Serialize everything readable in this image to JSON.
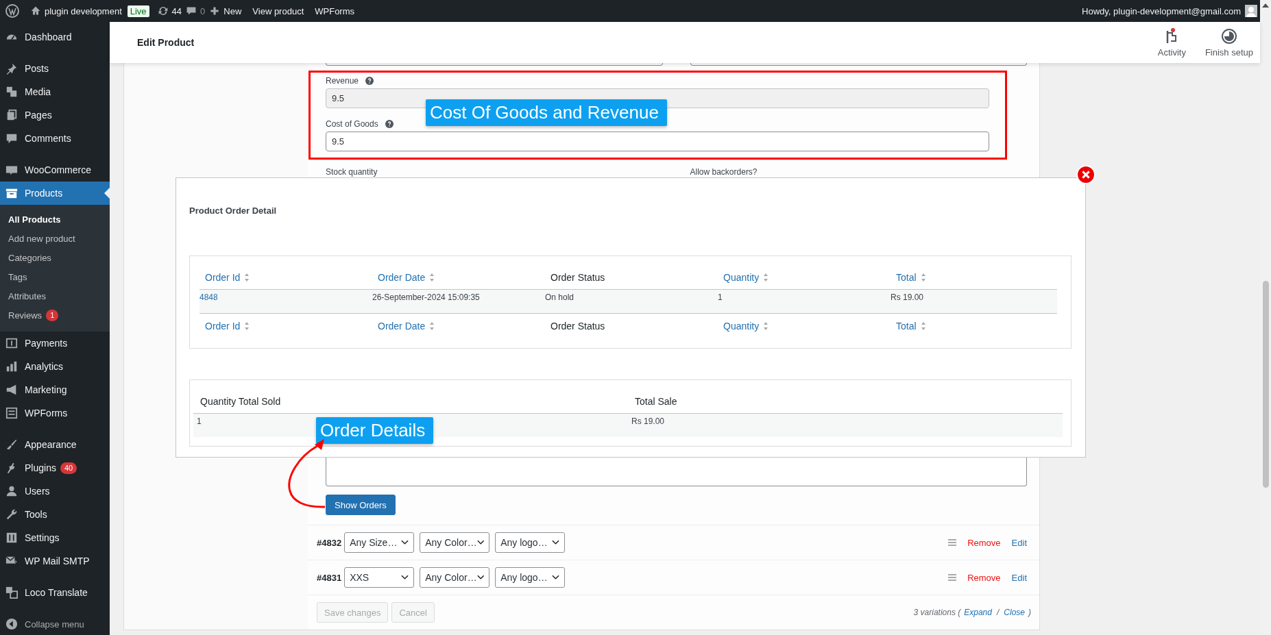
{
  "admin_bar": {
    "site": "plugin development",
    "badge": "Live",
    "updates": "44",
    "comments": "0",
    "new": "New",
    "links": [
      "View product",
      "WPForms"
    ],
    "greeting": "Howdy, plugin-development@gmail.com"
  },
  "sidebar": {
    "groups": [
      [
        {
          "label": "Dashboard",
          "selected": false
        }
      ],
      [
        {
          "label": "Posts",
          "selected": false
        },
        {
          "label": "Media",
          "selected": false
        },
        {
          "label": "Pages",
          "selected": false
        },
        {
          "label": "Comments",
          "selected": false
        }
      ],
      [
        {
          "label": "WooCommerce",
          "selected": false
        },
        {
          "label": "Products",
          "selected": true,
          "children": [
            {
              "label": "All Products",
              "selected": true
            },
            {
              "label": "Add new product",
              "selected": false
            },
            {
              "label": "Categories",
              "selected": false
            },
            {
              "label": "Tags",
              "selected": false
            },
            {
              "label": "Attributes",
              "selected": false
            },
            {
              "label": "Reviews",
              "selected": false,
              "badge": "1"
            }
          ]
        },
        {
          "label": "Payments",
          "selected": false
        },
        {
          "label": "Analytics",
          "selected": false
        },
        {
          "label": "Marketing",
          "selected": false
        },
        {
          "label": "WPForms",
          "selected": false
        }
      ],
      [
        {
          "label": "Appearance",
          "selected": false
        },
        {
          "label": "Plugins",
          "selected": false,
          "badge": "40"
        },
        {
          "label": "Users",
          "selected": false
        },
        {
          "label": "Tools",
          "selected": false
        },
        {
          "label": "Settings",
          "selected": false
        },
        {
          "label": "WP Mail SMTP",
          "selected": false
        }
      ],
      [
        {
          "label": "Loco Translate",
          "selected": false
        }
      ]
    ],
    "collapse": "Collapse menu"
  },
  "header": {
    "title": "Edit Product",
    "actions": [
      "Activity",
      "Finish setup"
    ]
  },
  "form": {
    "revenue": {
      "label": "Revenue",
      "value": "9.5",
      "disabled": true
    },
    "cost_of_goods": {
      "label": "Cost of Goods",
      "value": "9.5",
      "disabled": false
    },
    "stock_label": "Stock quantity",
    "backorders_label": "Allow backorders?",
    "show_orders": "Show Orders",
    "variations": [
      {
        "id": "#4832",
        "selects": [
          "Any Size…",
          "Any Color…",
          "Any logo…"
        ],
        "remove": "Remove",
        "edit": "Edit"
      },
      {
        "id": "#4831",
        "selects": [
          "XXS",
          "Any Color…",
          "Any logo…"
        ],
        "remove": "Remove",
        "edit": "Edit"
      }
    ],
    "footer": {
      "save": {
        "label": "Save changes",
        "disabled": true
      },
      "cancel": {
        "label": "Cancel",
        "disabled": true
      },
      "lead": "3 variations (",
      "expand": "Expand",
      "sep": "/",
      "close": "Close",
      "tail": ")"
    }
  },
  "modal": {
    "title": "Product Order Detail",
    "orders_table": {
      "columns": [
        {
          "label": "Order Id",
          "sortable": true
        },
        {
          "label": "Order Date",
          "sortable": true
        },
        {
          "label": "Order Status",
          "sortable": false
        },
        {
          "label": "Quantity",
          "sortable": true
        },
        {
          "label": "Total",
          "sortable": true
        }
      ],
      "rows": [
        [
          "4848",
          "26-September-2024 15:09:35",
          "On hold",
          "1",
          "Rs 19.00"
        ]
      ],
      "footer_columns": [
        {
          "label": "Order Id",
          "sortable": true
        },
        {
          "label": "Order Date",
          "sortable": true
        },
        {
          "label": "Order Status",
          "sortable": false
        },
        {
          "label": "Quantity",
          "sortable": true
        },
        {
          "label": "Total",
          "sortable": true
        }
      ]
    },
    "summary_table": {
      "columns": [
        "Quantity Total Sold",
        "Total Sale"
      ],
      "rows": [
        [
          "1",
          "Rs 19.00"
        ]
      ]
    }
  },
  "callouts": [
    "Cost Of Goods and Revenue",
    "Order Details"
  ]
}
